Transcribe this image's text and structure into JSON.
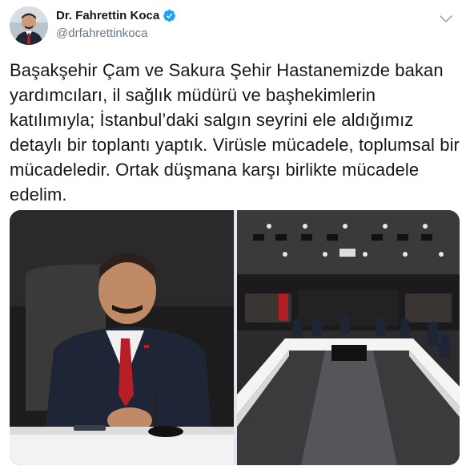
{
  "user": {
    "display_name": "Dr. Fahrettin Koca",
    "handle": "@drfahrettinkoca",
    "verified": true
  },
  "tweet": {
    "text": "Başakşehir Çam ve Sakura Şehir Hastanemizde bakan yardımcıları, il sağlık müdürü ve başhekimlerin katılımıyla; İstanbul’daki salgın seyrini ele aldığımız detaylı bir toplantı yaptık. Virüsle mücadele, toplumsal bir mücadeledir. Ortak düşmana karşı birlikte mücadele edelim."
  },
  "media": {
    "photos": [
      {
        "icon": "portrait-photo"
      },
      {
        "icon": "meeting-room-photo"
      }
    ]
  },
  "colors": {
    "name": "#14171a",
    "handle": "#657786",
    "verified": "#1da1f2"
  }
}
